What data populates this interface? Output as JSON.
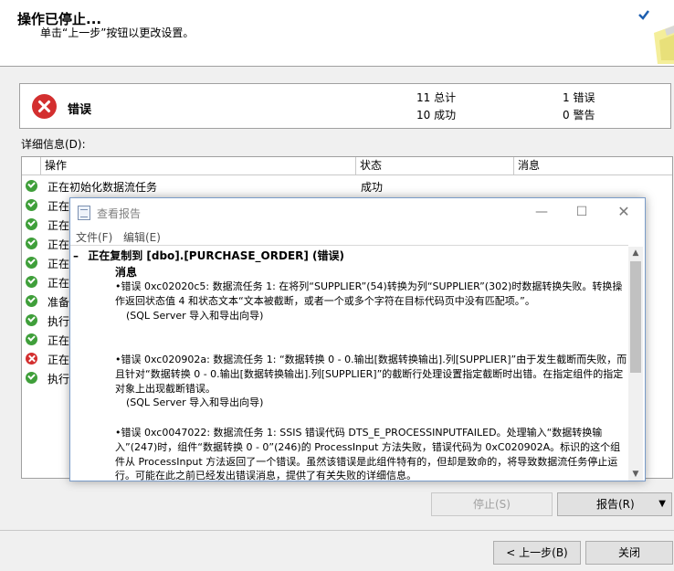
{
  "header": {
    "title": "操作已停止...",
    "subtitle": "单击“上一步”按钮以更改设置。"
  },
  "summary": {
    "status_label": "错误",
    "total": "11 总计",
    "success": "10 成功",
    "errors": "1 错误",
    "warnings": "0 警告"
  },
  "details_label": "详细信息(D):",
  "grid": {
    "columns": [
      "操作",
      "状态",
      "消息"
    ],
    "rows": [
      {
        "action": "正在初始化数据流任务",
        "status": "成功",
        "icon": "success-icon"
      },
      {
        "action": "正在",
        "status": "",
        "icon": "success-icon"
      },
      {
        "action": "正在",
        "status": "",
        "icon": "success-icon"
      },
      {
        "action": "正在",
        "status": "",
        "icon": "success-icon"
      },
      {
        "action": "正在",
        "status": "",
        "icon": "success-icon"
      },
      {
        "action": "正在",
        "status": "",
        "icon": "success-icon"
      },
      {
        "action": "准备",
        "status": "",
        "icon": "success-icon"
      },
      {
        "action": "执行",
        "status": "",
        "icon": "success-icon"
      },
      {
        "action": "正在",
        "status": "",
        "icon": "success-icon"
      },
      {
        "action": "正在",
        "status": "",
        "icon": "error-icon"
      },
      {
        "action": "执行",
        "status": "",
        "icon": "success-icon"
      }
    ]
  },
  "buttons": {
    "stop": "停止(S)",
    "report": "报告(R)",
    "back": "< 上一步(B)",
    "close": "关闭"
  },
  "report_window": {
    "title": "查看报告",
    "menu": [
      "文件(F)",
      "编辑(E)"
    ],
    "heading": "正在复制到 [dbo].[PURCHASE_ORDER] (错误)",
    "messages_label": "消息",
    "errors": [
      {
        "text": "•错误 0xc02020c5: 数据流任务 1: 在将列“SUPPLIER”(54)转换为列“SUPPLIER”(302)时数据转换失败。转换操作返回状态值 4 和状态文本“文本被截断，或者一个或多个字符在目标代码页中没有匹配项。”。",
        "source": "(SQL Server 导入和导出向导)"
      },
      {
        "text": "•错误 0xc020902a: 数据流任务 1: “数据转换 0 - 0.输出[数据转换输出].列[SUPPLIER]”由于发生截断而失败，而且针对“数据转换 0 - 0.输出[数据转换输出].列[SUPPLIER]”的截断行处理设置指定截断时出错。在指定组件的指定对象上出现截断错误。",
        "source": "(SQL Server 导入和导出向导)"
      },
      {
        "text": "•错误 0xc0047022: 数据流任务 1: SSIS 错误代码 DTS_E_PROCESSINPUTFAILED。处理输入“数据转换输入”(247)时，组件“数据转换 0 - 0”(246)的 ProcessInput 方法失败，错误代码为 0xC020902A。标识的这个组件从 ProcessInput 方法返回了一个错误。虽然该错误是此组件特有的，但却是致命的，将导致数据流任务停止运行。可能在此之前已经发出错误消息，提供了有关失败的详细信息。",
        "source": ""
      }
    ]
  },
  "colors": {
    "error_red": "#d32f2f",
    "success_green": "#3f9f3a",
    "accent_blue": "#1e5fb0"
  }
}
